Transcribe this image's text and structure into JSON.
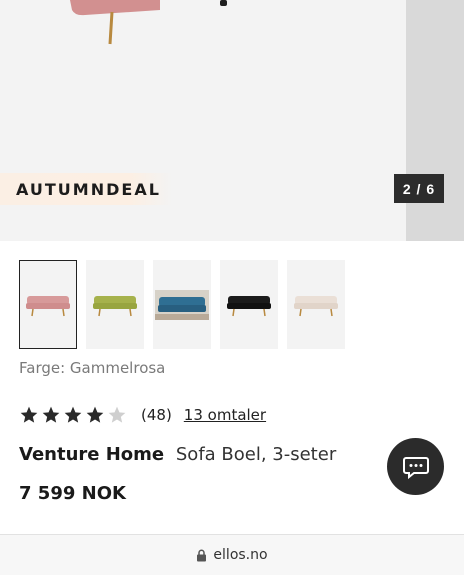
{
  "hero": {
    "promo_label": "AUTUMNDEAL",
    "pager": "2 / 6"
  },
  "thumbnails": [
    {
      "color": "#d79a9a",
      "selected": true
    },
    {
      "color": "#a6b24c",
      "selected": false
    },
    {
      "color": "#2f6f93",
      "selected": false
    },
    {
      "color": "#1b1b1b",
      "selected": false
    },
    {
      "color": "#eadfd6",
      "selected": false
    }
  ],
  "color": {
    "label": "Farge: Gammelrosa"
  },
  "rating": {
    "stars_filled": 4,
    "stars_total": 5,
    "count": "(48)",
    "reviews_link": "13 omtaler"
  },
  "product": {
    "brand": "Venture Home",
    "name": "Sofa Boel, 3-seter",
    "price": "7 599 NOK"
  },
  "chat": {
    "icon": "chat-bubble-icon"
  },
  "browser": {
    "url": "ellos.no",
    "icon": "lock-icon"
  }
}
